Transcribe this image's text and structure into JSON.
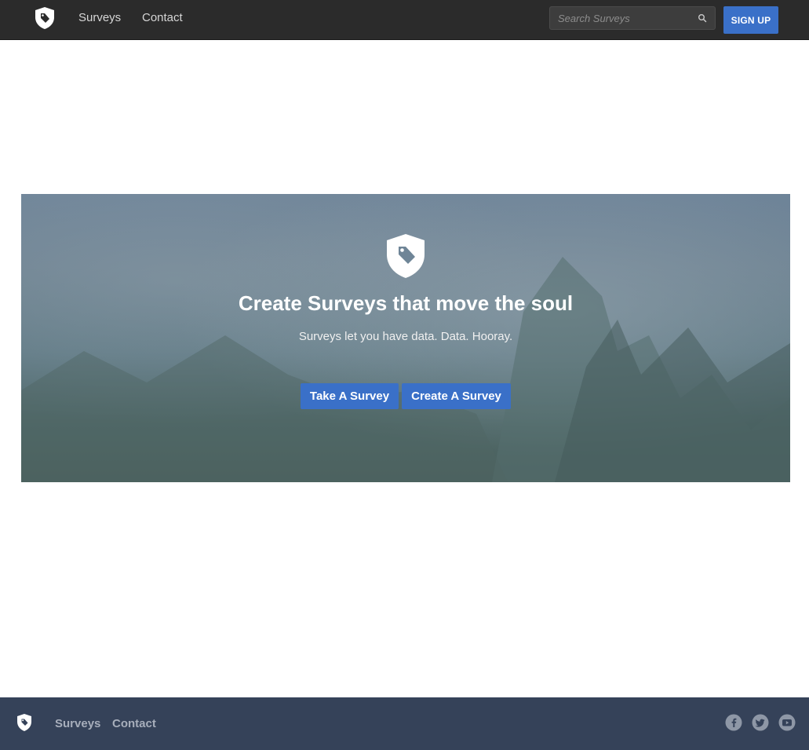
{
  "header": {
    "logo_icon": "shield-tag-icon",
    "nav": [
      {
        "label": "Surveys"
      },
      {
        "label": "Contact"
      }
    ],
    "search": {
      "placeholder": "Search Surveys",
      "value": "",
      "icon": "search-icon"
    },
    "signup_label": "SIGN UP"
  },
  "hero": {
    "logo_icon": "shield-tag-icon",
    "title": "Create Surveys that move the soul",
    "subtitle": "Surveys let you have data. Data. Hooray.",
    "buttons": [
      {
        "label": "Take A Survey"
      },
      {
        "label": "Create A Survey"
      }
    ]
  },
  "footer": {
    "logo_icon": "shield-tag-icon",
    "nav": [
      {
        "label": "Surveys"
      },
      {
        "label": "Contact"
      }
    ],
    "social": [
      "facebook-icon",
      "twitter-icon",
      "youtube-icon"
    ]
  },
  "colors": {
    "accent": "#3a70c8",
    "topbar": "#2b2b2b",
    "footer": "#354259"
  }
}
